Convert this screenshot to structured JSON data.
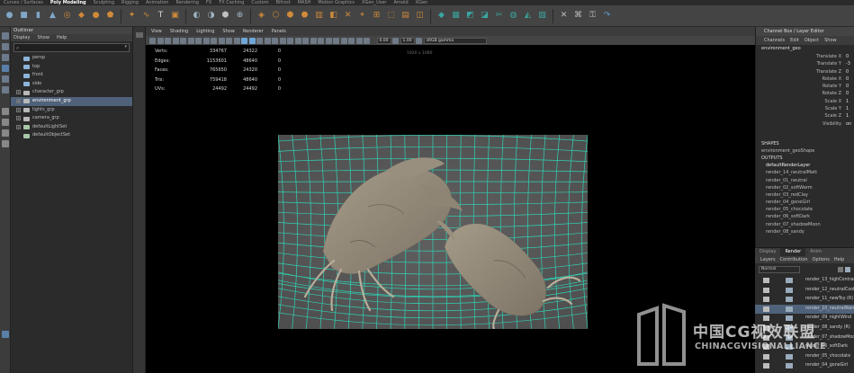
{
  "shelf_tabs": [
    "Curves / Surfaces",
    "Poly Modeling",
    "Sculpting",
    "Rigging",
    "Animation",
    "Rendering",
    "FX",
    "FX Caching",
    "Custom",
    "Bifrost",
    "MASH",
    "Motion Graphics",
    "XGen_User",
    "Arnold",
    "XGen"
  ],
  "active_shelf_tab": "Poly Modeling",
  "outliner": {
    "title": "Outliner",
    "menu": [
      "Display",
      "Show",
      "Help"
    ],
    "search_placeholder": "",
    "items": [
      {
        "label": "persp",
        "icon": "camera-icon",
        "expandable": false,
        "selected": false
      },
      {
        "label": "top",
        "icon": "camera-icon",
        "expandable": false,
        "selected": false
      },
      {
        "label": "front",
        "icon": "camera-icon",
        "expandable": false,
        "selected": false
      },
      {
        "label": "side",
        "icon": "camera-icon",
        "expandable": false,
        "selected": false
      },
      {
        "label": "character_grp",
        "icon": "group-icon",
        "expandable": true,
        "selected": false
      },
      {
        "label": "environment_grp",
        "icon": "group-icon",
        "expandable": true,
        "selected": true
      },
      {
        "label": "lights_grp",
        "icon": "group-icon",
        "expandable": true,
        "selected": false
      },
      {
        "label": "camera_grp",
        "icon": "group-icon",
        "expandable": true,
        "selected": false
      },
      {
        "label": "defaultLightSet",
        "icon": "set-icon",
        "expandable": true,
        "selected": false
      },
      {
        "label": "defaultObjectSet",
        "icon": "set-icon",
        "expandable": false,
        "selected": false
      }
    ]
  },
  "viewport": {
    "menu": [
      "View",
      "Shading",
      "Lighting",
      "Show",
      "Renderer",
      "Panels"
    ],
    "exposure": "0.00",
    "gamma": "1.00",
    "color_space": "sRGB gamma",
    "resolution_label": "1920 x 1080",
    "hud": [
      {
        "label": "Verts:",
        "v1": "334767",
        "v2": "24322",
        "v3": "0"
      },
      {
        "label": "Edges:",
        "v1": "1153601",
        "v2": "48640",
        "v3": "0"
      },
      {
        "label": "Faces:",
        "v1": "765650",
        "v2": "24320",
        "v3": "0"
      },
      {
        "label": "Tris:",
        "v1": "759418",
        "v2": "48640",
        "v3": "0"
      },
      {
        "label": "UVs:",
        "v1": "24492",
        "v2": "24492",
        "v3": "0"
      }
    ]
  },
  "channel_box": {
    "title": "Channel Box / Layer Editor",
    "menu": [
      "Channels",
      "Edit",
      "Object",
      "Show"
    ],
    "object": "environment_geo",
    "attributes": [
      {
        "name": "Translate X",
        "value": "0"
      },
      {
        "name": "Translate Y",
        "value": "-3"
      },
      {
        "name": "Translate Z",
        "value": "0"
      },
      {
        "name": "Rotate X",
        "value": "0"
      },
      {
        "name": "Rotate Y",
        "value": "0"
      },
      {
        "name": "Rotate Z",
        "value": "0"
      },
      {
        "name": "Scale X",
        "value": "1"
      },
      {
        "name": "Scale Y",
        "value": "1"
      },
      {
        "name": "Scale Z",
        "value": "1"
      },
      {
        "name": "Visibility",
        "value": "on"
      }
    ],
    "shapes_header": "SHAPES",
    "shape": "environment_geoShape",
    "outputs_header": "OUTPUTS",
    "outputs": [
      "defaultRenderLayer",
      "render_14_neutralMatt",
      "render_01_neutral",
      "render_02_softWarm",
      "render_03_redClay",
      "render_04_goneGirl",
      "render_05_chocolate",
      "render_06_softDark",
      "render_07_shadowMoon",
      "render_08_sandy"
    ]
  },
  "layer_editor": {
    "tabs": [
      "Display",
      "Render",
      "Anim"
    ],
    "active_tab": "Render",
    "menu": [
      "Layers",
      "Contribution",
      "Options",
      "Help"
    ],
    "mode": "Normal",
    "layers": [
      {
        "name": "render_13_highContrast",
        "selected": false
      },
      {
        "name": "render_12_neutralCool",
        "selected": false
      },
      {
        "name": "render_11_newToy (R)",
        "selected": false
      },
      {
        "name": "render_10_neutralWarm",
        "selected": true
      },
      {
        "name": "render_09_nightWind",
        "selected": false
      },
      {
        "name": "render_08_sandy (R)",
        "selected": false
      },
      {
        "name": "render_07_shadowMoon",
        "selected": false
      },
      {
        "name": "render_06_softDark",
        "selected": false
      },
      {
        "name": "render_05_chocolate",
        "selected": false
      },
      {
        "name": "render_04_goneGirl",
        "selected": false
      }
    ]
  },
  "watermark": {
    "title": "中国CG视效联盟",
    "subtitle": "CHINACGVISIONALLIANCE"
  },
  "colors": {
    "accent_selected": "#50627a",
    "grid": "#2fd3b4",
    "model": "#8f8676"
  }
}
